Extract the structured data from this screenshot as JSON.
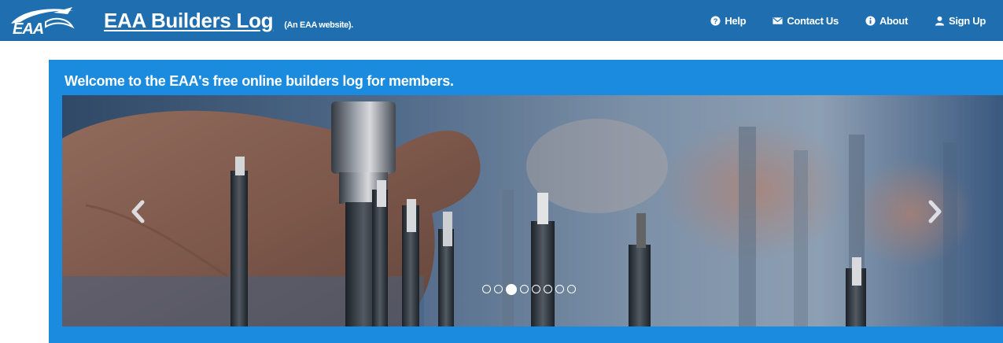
{
  "header": {
    "logo_text": "EAA",
    "title": "EAA Builders Log",
    "subtitle": "(An EAA website).",
    "nav": [
      {
        "label": "Help",
        "icon": "question-circle-icon"
      },
      {
        "label": "Contact Us",
        "icon": "envelope-icon"
      },
      {
        "label": "About",
        "icon": "info-circle-icon"
      },
      {
        "label": "Sign Up",
        "icon": "user-icon"
      }
    ]
  },
  "welcome": {
    "heading": "Welcome to the EAA's free online builders log for members."
  },
  "carousel": {
    "slide_count": 8,
    "active_index": 2,
    "prev_icon": "chevron-left-icon",
    "next_icon": "chevron-right-icon"
  },
  "colors": {
    "navbar": "#1f6fb0",
    "panel": "#1b8be0",
    "text": "#ffffff"
  }
}
